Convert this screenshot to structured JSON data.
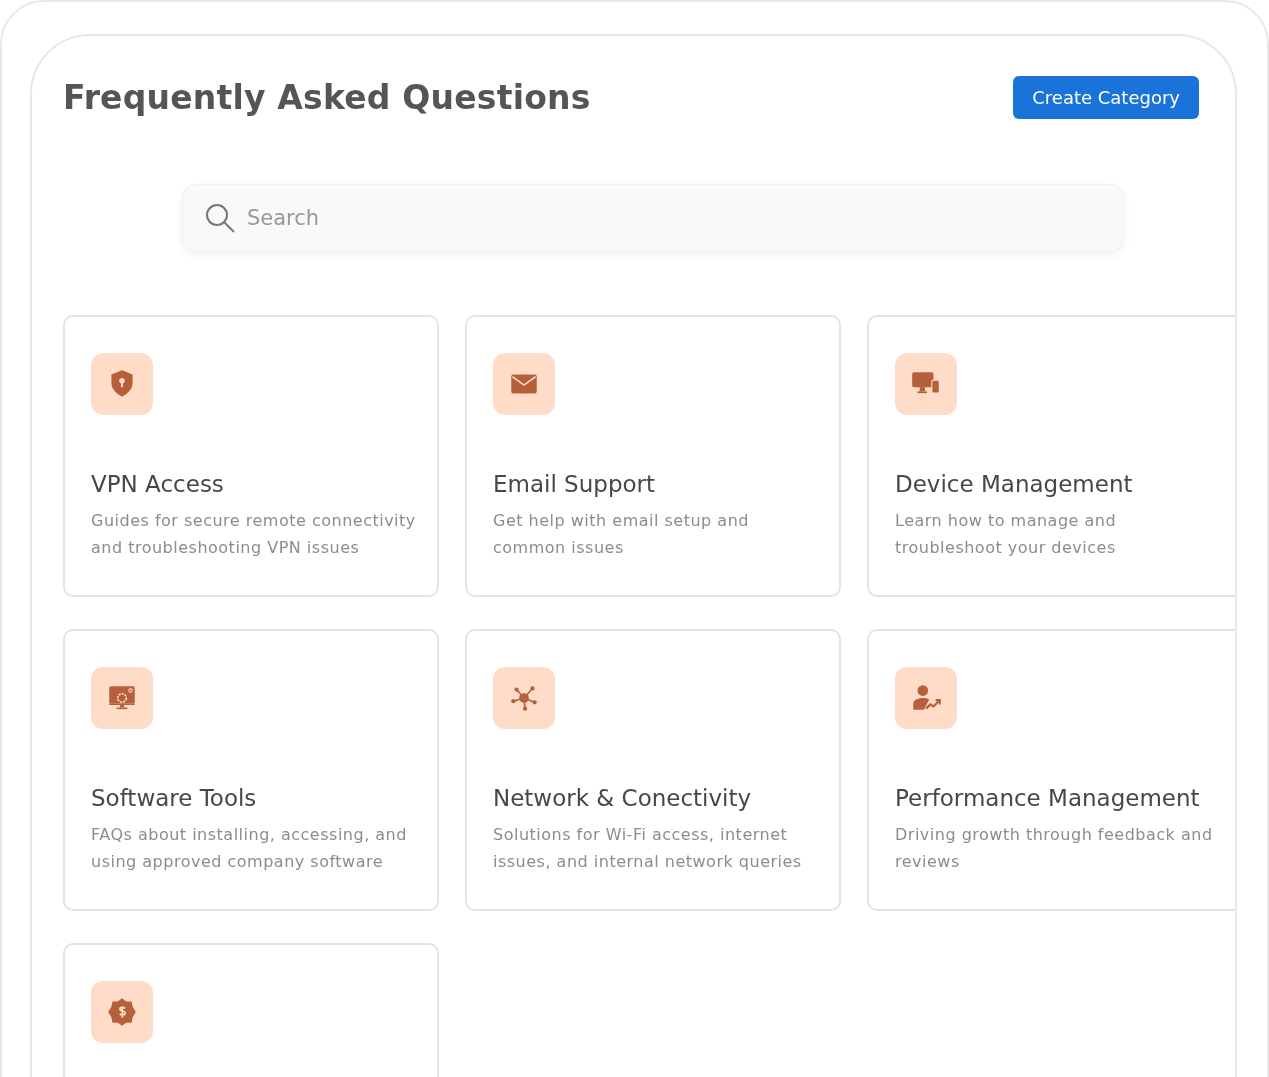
{
  "header": {
    "title": "Frequently Asked Questions",
    "create_button": "Create Category"
  },
  "search": {
    "placeholder": "Search"
  },
  "categories": [
    {
      "kind": "full",
      "title": "VPN Access",
      "description": "Guides for secure remote connectivity and troubleshooting VPN issues"
    },
    {
      "kind": "full",
      "title": "Email Support",
      "description": "Get help with email setup and common issues"
    },
    {
      "kind": "full",
      "title": "Device Management",
      "description": "Learn how to manage and troubleshoot your devices"
    },
    {
      "kind": "full",
      "title": "Software Tools",
      "description": "FAQs about installing, accessing, and using approved company software"
    },
    {
      "kind": "full",
      "title": "Network & Conectivity",
      "description": "Solutions for Wi-Fi access, internet issues, and internal network queries"
    },
    {
      "kind": "full",
      "title": "Performance Management",
      "description": "Driving growth through feedback and reviews"
    },
    {
      "kind": "icon_only"
    }
  ]
}
